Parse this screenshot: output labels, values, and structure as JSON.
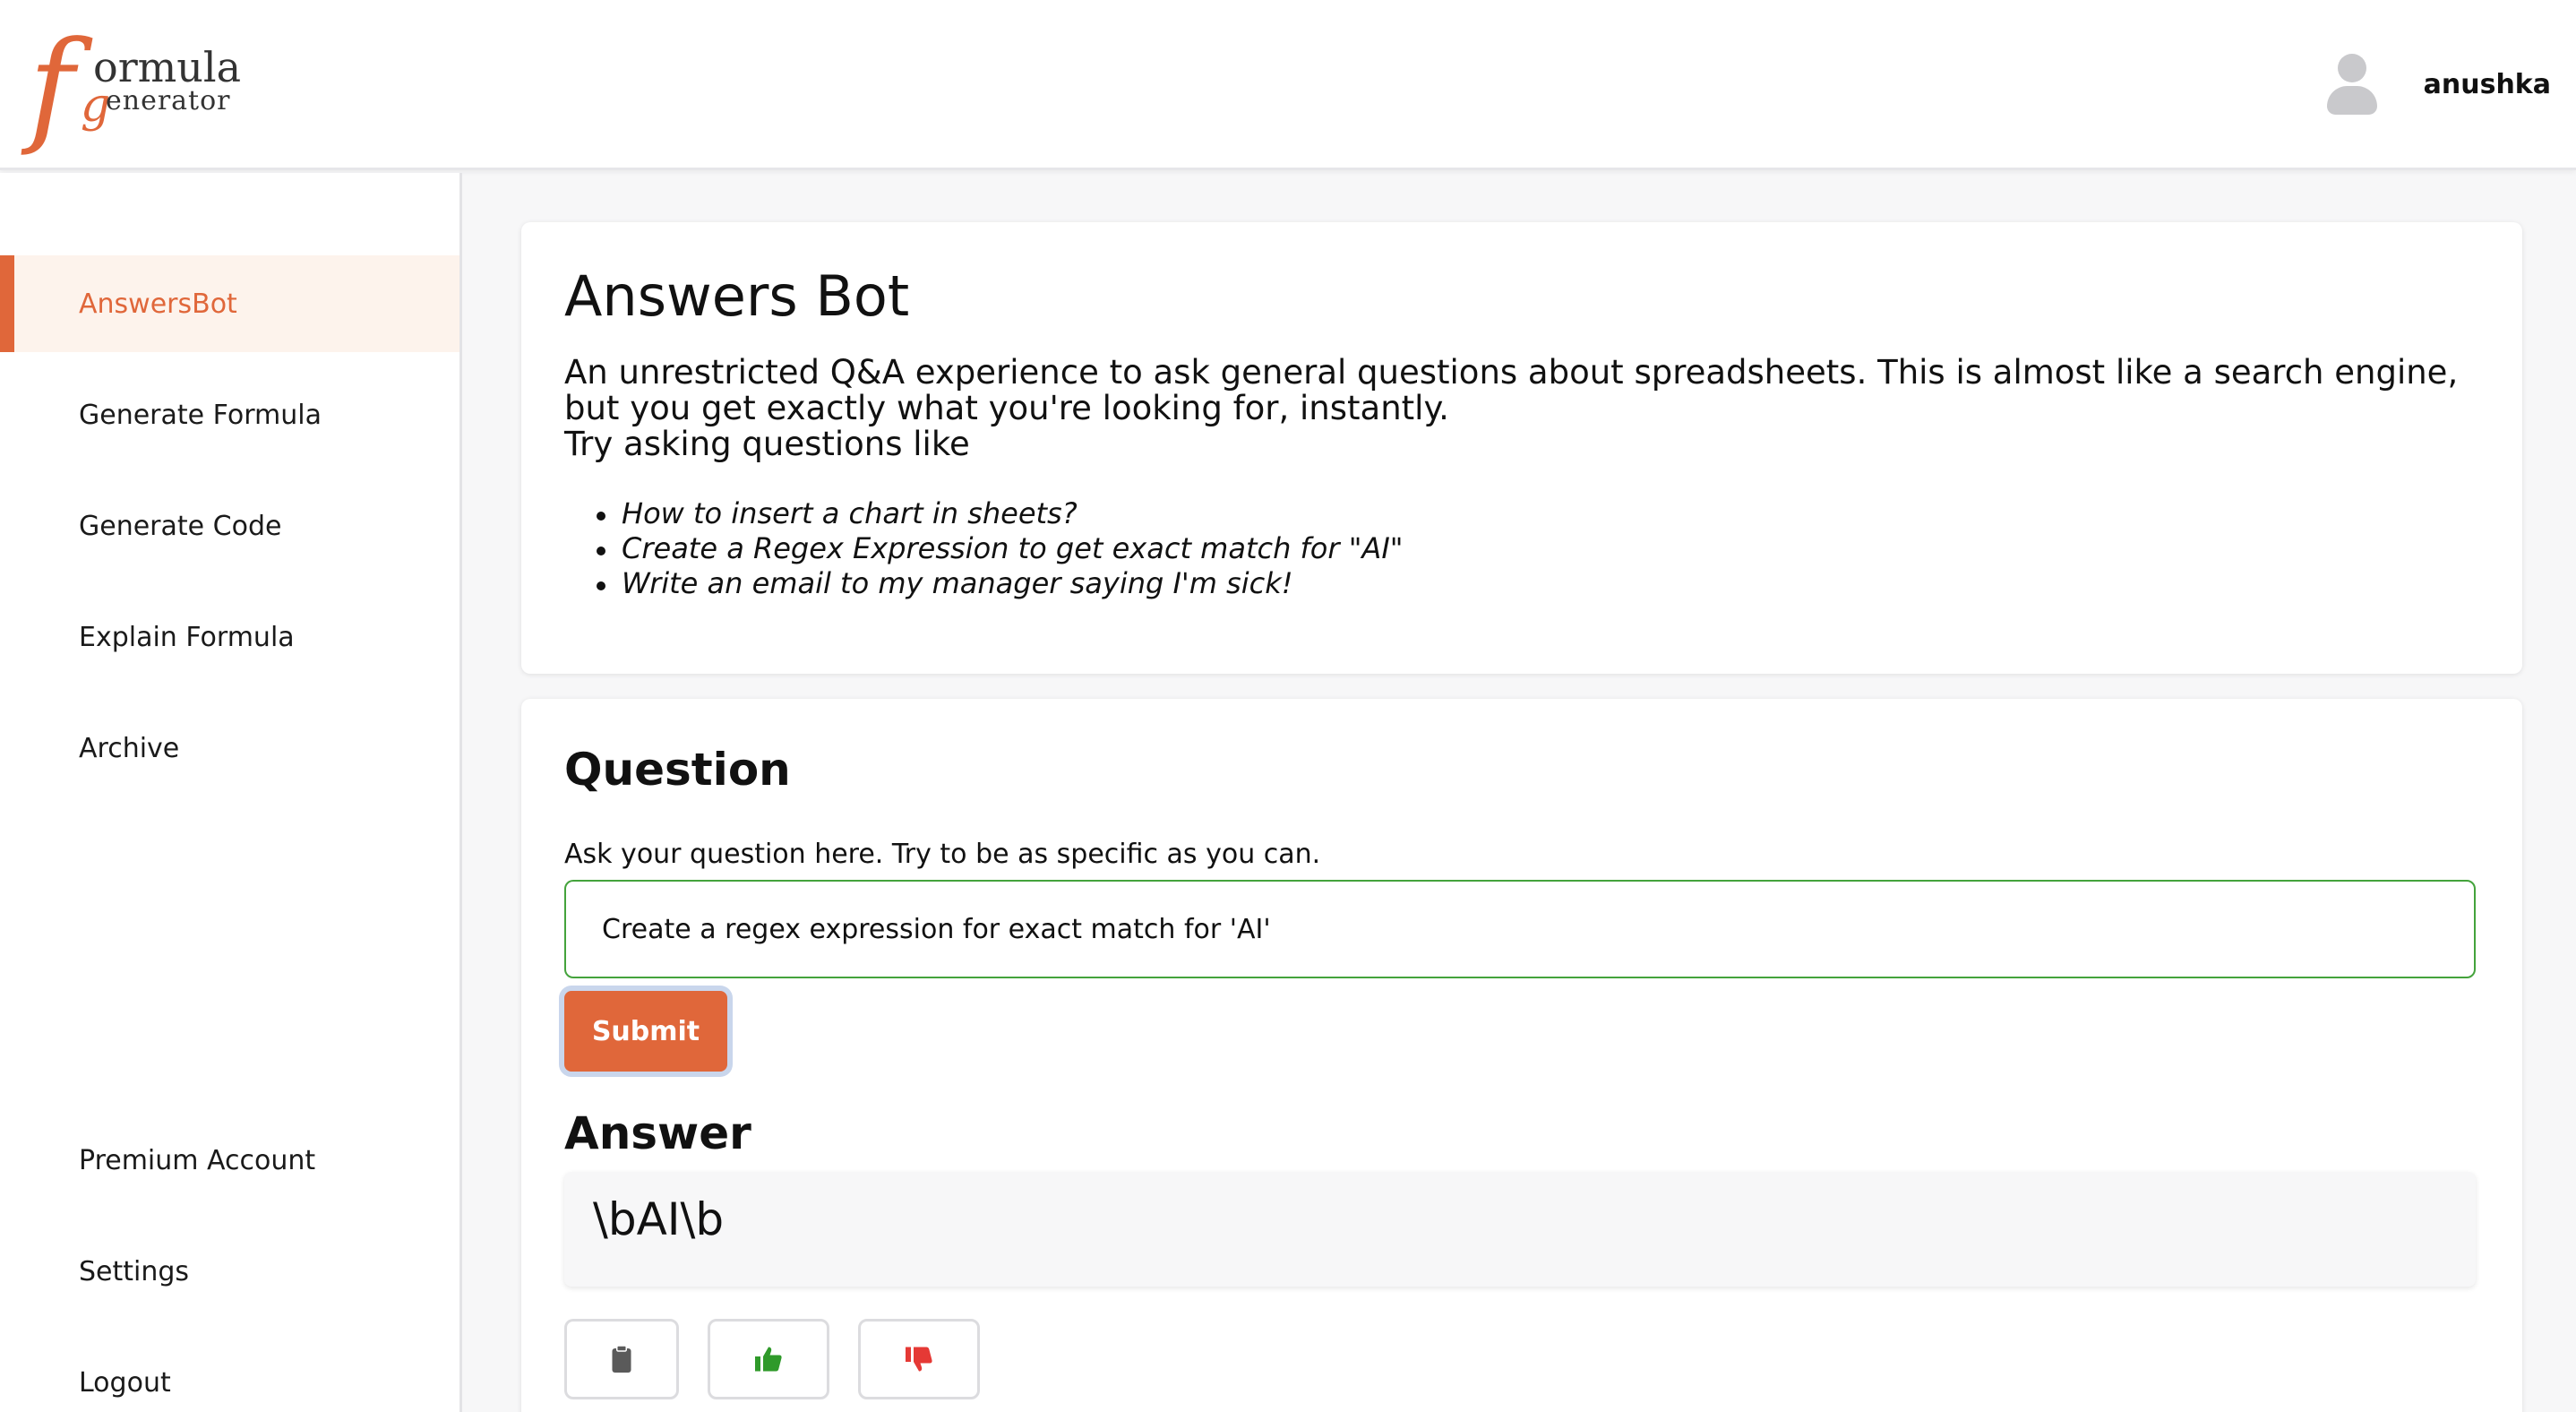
{
  "brand": {
    "logo_f": "f",
    "logo_word1": "ormula",
    "logo_g": "g",
    "logo_word2": "enerator"
  },
  "user": {
    "name": "anushka",
    "icon": "user-avatar-icon"
  },
  "sidebar": {
    "items": [
      {
        "label": "AnswersBot",
        "active": true
      },
      {
        "label": "Generate Formula"
      },
      {
        "label": "Generate Code"
      },
      {
        "label": "Explain Formula"
      },
      {
        "label": "Archive"
      },
      {
        "label": "Premium Account"
      },
      {
        "label": "Settings"
      },
      {
        "label": "Logout"
      }
    ]
  },
  "intro": {
    "title": "Answers Bot",
    "description": "An unrestricted Q&A experience to ask general questions about spreadsheets. This is almost like a search engine, but you get exactly what you're looking for, instantly.",
    "try_label": "Try asking questions like",
    "examples": [
      "How to insert a chart in sheets?",
      "Create a Regex Expression to get exact match for \"AI\"",
      "Write an email to my manager saying I'm sick!"
    ]
  },
  "question": {
    "title": "Question",
    "hint": "Ask your question here. Try to be as specific as you can.",
    "value": "Create a regex expression for exact match for 'AI'",
    "submit_label": "Submit"
  },
  "answer": {
    "title": "Answer",
    "text": "\\bAI\\b"
  },
  "actions": [
    {
      "icon": "clipboard-icon"
    },
    {
      "icon": "thumbs-up-icon"
    },
    {
      "icon": "thumbs-down-icon"
    }
  ],
  "colors": {
    "accent": "#e0673a",
    "active_bg": "#fdf3ec",
    "input_border": "#44a33c",
    "thumbs_up": "#2f9a2a",
    "thumbs_down": "#e53935"
  }
}
